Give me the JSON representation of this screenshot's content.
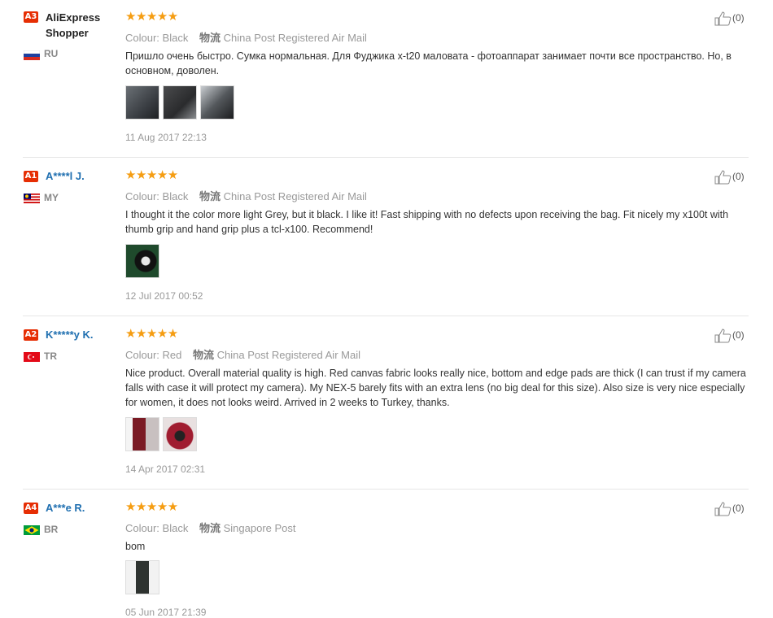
{
  "reviews": [
    {
      "badge": "A3",
      "name": "AliExpress Shopper",
      "country": "RU",
      "flag_colors": [
        "#ffffff",
        "#1c3f9e",
        "#d52b1e"
      ],
      "rating_stars": "★★★★★",
      "colour_label": "Colour:",
      "colour": "Black",
      "shipping_label": "物流",
      "shipping": "China Post Registered Air Mail",
      "text": "Пришло очень быстро. Сумка нормальная. Для Фуджика x-t20 маловата - фотоаппарат занимает почти все пространство. Но, в основном, доволен.",
      "photos": [
        "photo-1",
        "photo-2",
        "photo-3"
      ],
      "photo_colors": [
        "#3b3f44",
        "#2a2b2d",
        "#54585c"
      ],
      "date": "11 Aug 2017 22:13",
      "likes": "(0)"
    },
    {
      "badge": "A1",
      "name": "A****l J.",
      "country": "MY",
      "flag_colors": [
        "#cc0000",
        "#ffffff",
        "#010066"
      ],
      "rating_stars": "★★★★★",
      "colour_label": "Colour:",
      "colour": "Black",
      "shipping_label": "物流",
      "shipping": "China Post Registered Air Mail",
      "text": "I thought it the color more light Grey, but it black. I like it! Fast shipping with no defects upon receiving the bag. Fit nicely my x100t with thumb grip and hand grip plus a tcl-x100. Recommend!",
      "photos": [
        "photo-1"
      ],
      "photo_colors": [
        "#1f4a2c"
      ],
      "date": "12 Jul 2017 00:52",
      "likes": "(0)"
    },
    {
      "badge": "A2",
      "name": "K*****y K.",
      "country": "TR",
      "flag_colors": [
        "#e30a17",
        "#ffffff"
      ],
      "rating_stars": "★★★★★",
      "colour_label": "Colour:",
      "colour": "Red",
      "shipping_label": "物流",
      "shipping": "China Post Registered Air Mail",
      "text": "Nice product. Overall material quality is high. Red canvas fabric looks really nice, bottom and edge pads are thick (I can trust if my camera falls with case it will protect my camera). My NEX-5 barely fits with an extra lens (no big deal for this size). Also size is very nice especially for women, it does not looks weird. Arrived in 2 weeks to Turkey, thanks.",
      "photos": [
        "photo-1",
        "photo-2"
      ],
      "photo_colors": [
        "#7a1a24",
        "#a01c30"
      ],
      "date": "14 Apr 2017 02:31",
      "likes": "(0)"
    },
    {
      "badge": "A4",
      "name": "A***e R.",
      "country": "BR",
      "flag_colors": [
        "#009c3b",
        "#ffdf00",
        "#002776"
      ],
      "rating_stars": "★★★★★",
      "colour_label": "Colour:",
      "colour": "Black",
      "shipping_label": "物流",
      "shipping": "Singapore Post",
      "text": "bom",
      "photos": [
        "photo-1"
      ],
      "photo_colors": [
        "#2e3330"
      ],
      "date": "05 Jun 2017 21:39",
      "likes": "(0)"
    }
  ]
}
